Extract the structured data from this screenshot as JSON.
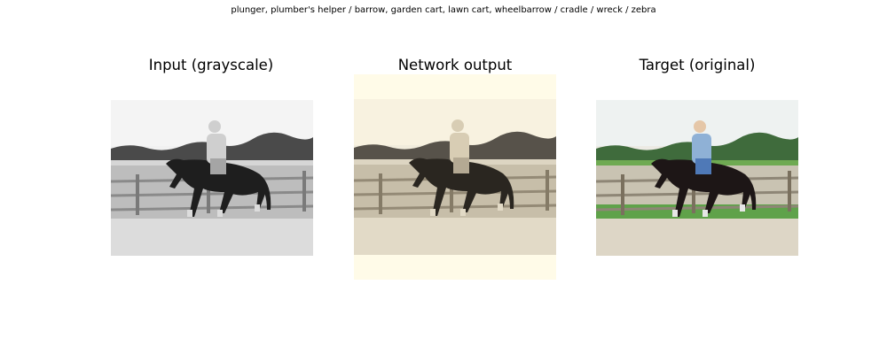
{
  "figure": {
    "suptitle": "plunger, plumber's helper / barrow, garden cart, lawn cart, wheelbarrow / cradle / wreck / zebra"
  },
  "panels": [
    {
      "title": "Input (grayscale)",
      "style": "grayscale"
    },
    {
      "title": "Network output",
      "style": "sepia",
      "tint": "#fffbe8"
    },
    {
      "title": "Target (original)",
      "style": "color"
    }
  ],
  "colors": {
    "sky": "#f3f5f4",
    "trees_color": "#3f6b3c",
    "grass_color": "#5fa24a",
    "rider_top": "#8fb1d6",
    "horse": "#1d1616"
  }
}
